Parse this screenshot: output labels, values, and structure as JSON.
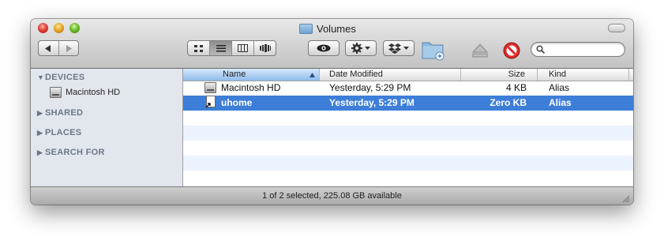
{
  "window": {
    "title": "Volumes"
  },
  "toolbar": {
    "back_icon": "back-arrow-icon",
    "forward_icon": "forward-arrow-icon",
    "view_modes": [
      "icon-view",
      "list-view",
      "column-view",
      "coverflow-view"
    ],
    "active_view": "list-view",
    "quick_look_icon": "eye-icon",
    "action_icon": "gear-icon",
    "dropbox_icon": "dropbox-icon",
    "new_folder_icon": "new-folder-icon",
    "eject_icon": "eject-icon",
    "burn_icon": "no-entry-icon",
    "search": {
      "placeholder": "",
      "value": ""
    }
  },
  "sidebar": {
    "sections": [
      {
        "label": "DEVICES",
        "expanded": true,
        "items": [
          {
            "label": "Macintosh HD",
            "icon": "hard-drive-icon"
          }
        ]
      },
      {
        "label": "SHARED",
        "expanded": false,
        "items": []
      },
      {
        "label": "PLACES",
        "expanded": false,
        "items": []
      },
      {
        "label": "SEARCH FOR",
        "expanded": false,
        "items": []
      }
    ]
  },
  "list": {
    "columns": [
      "Name",
      "Date Modified",
      "Size",
      "Kind"
    ],
    "sort_column": "Name",
    "rows": [
      {
        "name": "Macintosh HD",
        "date": "Yesterday, 5:29 PM",
        "size": "4 KB",
        "kind": "Alias",
        "icon": "hard-drive-icon",
        "selected": false
      },
      {
        "name": "uhome",
        "date": "Yesterday, 5:29 PM",
        "size": "Zero KB",
        "kind": "Alias",
        "icon": "alias-document-icon",
        "selected": true
      }
    ]
  },
  "status": {
    "text": "1 of 2 selected, 225.08 GB available"
  },
  "colors": {
    "selection": "#3d7ed8",
    "sidebar_bg": "#e2e7ee",
    "stripe": "#edf3fe"
  }
}
